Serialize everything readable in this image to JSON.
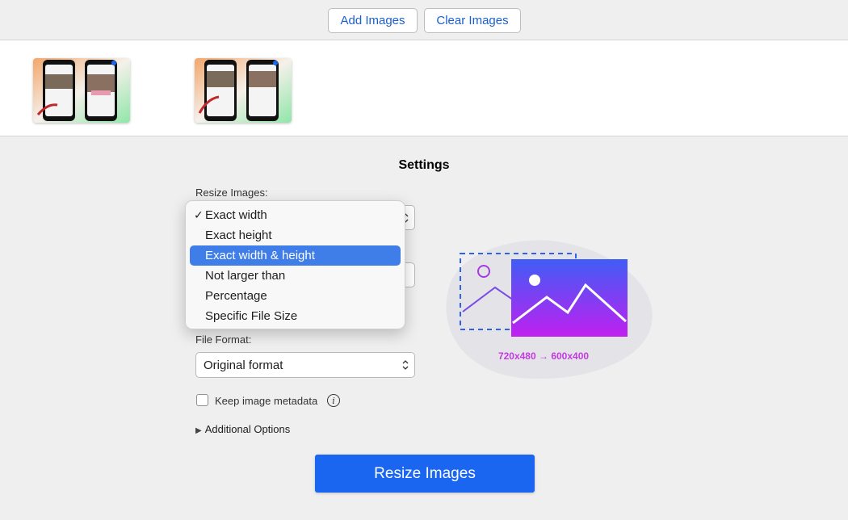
{
  "toolbar": {
    "add_label": "Add Images",
    "clear_label": "Clear Images"
  },
  "settings": {
    "title": "Settings",
    "resize_label": "Resize Images:",
    "resize_options": [
      "Exact width",
      "Exact height",
      "Exact width & height",
      "Not larger than",
      "Percentage",
      "Specific File Size"
    ],
    "resize_checked": "Exact width",
    "resize_highlighted": "Exact width & height",
    "format_label": "File Format:",
    "format_value": "Original format",
    "metadata_label": "Keep image metadata",
    "metadata_checked": false,
    "additional_options": "Additional Options",
    "resize_button": "Resize Images"
  },
  "illustration": {
    "dimensions": "720x480 → 600x400"
  },
  "colors": {
    "accent": "#1a66f0",
    "link": "#1a5fd0",
    "highlight": "#3f7ee8",
    "illustration_purple": "#c23be0"
  }
}
